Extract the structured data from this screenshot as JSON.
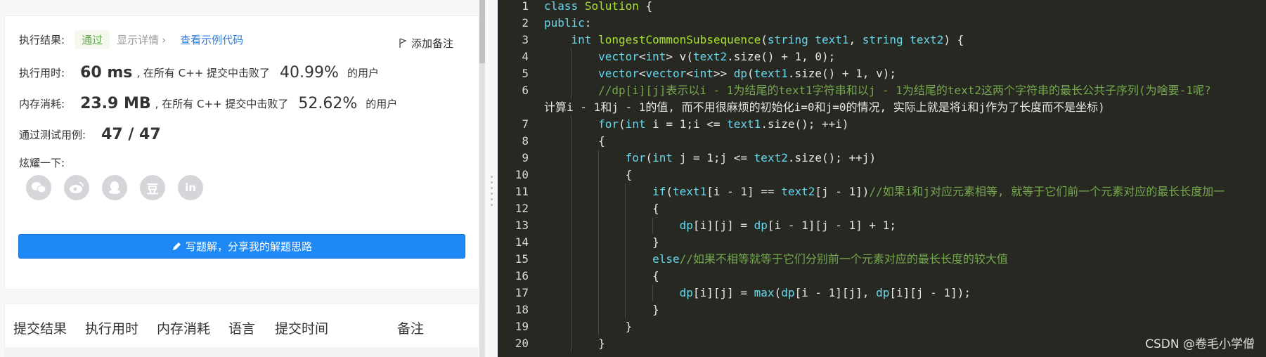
{
  "result": {
    "label": "执行结果:",
    "status": "通过",
    "detail_link": "显示详情",
    "example_link": "查看示例代码",
    "add_note": "添加备注"
  },
  "runtime": {
    "label": "执行用时:",
    "value": "60 ms",
    "mid": ", 在所有 C++ 提交中击败了",
    "percent": "40.99%",
    "suffix": "的用户"
  },
  "memory": {
    "label": "内存消耗:",
    "value": "23.9 MB",
    "mid": ", 在所有 C++ 提交中击败了",
    "percent": "52.62%",
    "suffix": "的用户"
  },
  "testcases": {
    "label": "通过测试用例:",
    "value": "47 / 47"
  },
  "share": {
    "label": "炫耀一下:",
    "icons": [
      "wechat-icon",
      "weibo-icon",
      "qq-icon",
      "douban-icon",
      "linkedin-icon"
    ],
    "douban_text": "豆",
    "linkedin_text": "in"
  },
  "write_button": "写题解，分享我的解题思路",
  "table": {
    "headers": [
      "提交结果",
      "执行用时",
      "内存消耗",
      "语言",
      "提交时间",
      "备注"
    ]
  },
  "colors": {
    "accent_blue": "#1e88f5",
    "pass_green": "#5aaa4a",
    "editor_bg": "#272822"
  },
  "code": {
    "line_numbers": [
      "1",
      "2",
      "3",
      "4",
      "5",
      "6",
      "7",
      "8",
      "9",
      "10",
      "11",
      "12",
      "13",
      "14",
      "15",
      "16",
      "17",
      "18",
      "19",
      "20"
    ],
    "lines": [
      "class Solution {",
      "public:",
      "    int longestCommonSubsequence(string text1, string text2) {",
      "        vector<int> v(text2.size() + 1, 0);",
      "        vector<vector<int>> dp(text1.size() + 1, v);",
      "        //dp[i][j]表示以i - 1为结尾的text1字符串和以j - 1为结尾的text2这两个字符串的最长公共子序列(为啥要-1呢?",
      "计算i - 1和j - 1的值, 而不用很麻烦的初始化i=0和j=0的情况, 实际上就是将i和j作为了长度而不是坐标)",
      "        for(int i = 1;i <= text1.size(); ++i)",
      "        {",
      "            for(int j = 1;j <= text2.size(); ++j)",
      "            {",
      "                if(text1[i - 1] == text2[j - 1])//如果i和j对应元素相等, 就等于它们前一个元素对应的最长长度加一",
      "                {",
      "                    dp[i][j] = dp[i - 1][j - 1] + 1;",
      "                }",
      "                else//如果不相等就等于它们分别前一个元素对应的最长长度的较大值",
      "                {",
      "                    dp[i][j] = max(dp[i - 1][j], dp[i][j - 1]);",
      "                }",
      "            }",
      "        }"
    ]
  },
  "watermark": "CSDN @卷毛小学僧"
}
